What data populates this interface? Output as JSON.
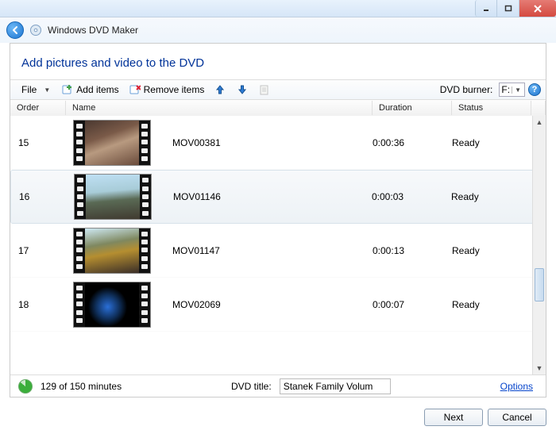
{
  "app_title": "Windows DVD Maker",
  "heading": "Add pictures and video to the DVD",
  "toolbar": {
    "file": "File",
    "add_items": "Add items",
    "remove_items": "Remove items",
    "burner_label": "DVD burner:",
    "burner_value": "F:"
  },
  "columns": {
    "order": "Order",
    "name": "Name",
    "duration": "Duration",
    "status": "Status"
  },
  "rows": [
    {
      "order": "15",
      "name": "MOV00381",
      "duration": "0:00:36",
      "status": "Ready",
      "frame_bg": "linear-gradient(160deg,#4a3830 0%,#7a5a48 35%,#b89a80 55%,#6a4b3b 100%)",
      "selected": false
    },
    {
      "order": "16",
      "name": "MOV01146",
      "duration": "0:00:03",
      "status": "Ready",
      "frame_bg": "linear-gradient(175deg,#bfe0f4 0%,#a8ccd8 38%,#5a6a55 58%,#403a30 100%)",
      "selected": true
    },
    {
      "order": "17",
      "name": "MOV01147",
      "duration": "0:00:13",
      "status": "Ready",
      "frame_bg": "linear-gradient(170deg,#cfeaf5 0%,#7f8860 35%,#b58e30 55%,#3a2e28 100%)",
      "selected": false
    },
    {
      "order": "18",
      "name": "MOV02069",
      "duration": "0:00:07",
      "status": "Ready",
      "frame_bg": "radial-gradient(40% 50% at 42% 55%,#2a6fd8 0%,#0f2f5a 55%,#000 90%)",
      "selected": false
    }
  ],
  "status": {
    "minutes_text": "129 of 150 minutes",
    "dvd_title_label": "DVD title:",
    "dvd_title_value": "Stanek Family Volum",
    "options": "Options"
  },
  "footer": {
    "next": "Next",
    "cancel": "Cancel"
  }
}
